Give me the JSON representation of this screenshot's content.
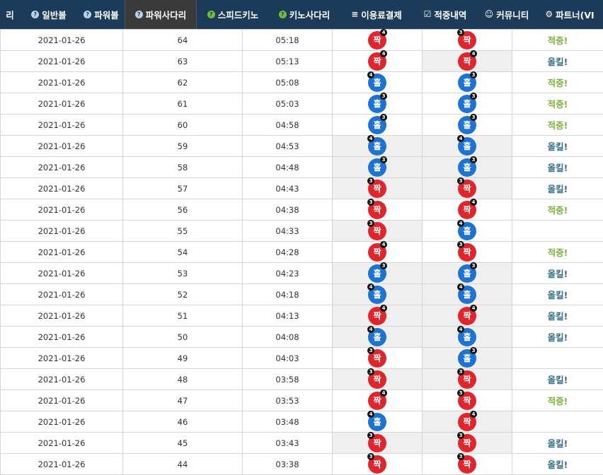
{
  "nav": {
    "items": [
      {
        "name": "nav-item-left-cut",
        "label": "리",
        "icon": "",
        "icon_type": "",
        "width": 28,
        "active": false
      },
      {
        "name": "nav-item-general-ball",
        "label": "일반볼",
        "icon": "?",
        "icon_type": "q",
        "width": 82,
        "active": false
      },
      {
        "name": "nav-item-powerball",
        "label": "파워볼",
        "icon": "?",
        "icon_type": "q",
        "width": 66,
        "active": false
      },
      {
        "name": "nav-item-power-ladder",
        "label": "파워사다리",
        "icon": "?",
        "icon_type": "q",
        "width": 102,
        "active": true
      },
      {
        "name": "nav-item-speed-keno",
        "label": "스피드키노",
        "icon": "?",
        "icon_type": "g",
        "width": 102,
        "active": false
      },
      {
        "name": "nav-item-keno-ladder",
        "label": "키노사다리",
        "icon": "?",
        "icon_type": "g",
        "width": 100,
        "active": false
      },
      {
        "name": "nav-item-payment",
        "label": "이용료결제",
        "icon": "≡",
        "icon_type": "plain",
        "width": 104,
        "active": false
      },
      {
        "name": "nav-item-hit-history",
        "label": "적중내역",
        "icon": "☑",
        "icon_type": "plain",
        "width": 90,
        "active": false
      },
      {
        "name": "nav-item-community",
        "label": "커뮤니티",
        "icon": "☺",
        "icon_type": "plain",
        "width": 84,
        "active": false
      },
      {
        "name": "nav-item-partner",
        "label": "파트너(VI",
        "icon": "⚙",
        "icon_type": "plain",
        "width": 94,
        "active": false
      }
    ]
  },
  "colors": {
    "even_ball": "#e0262d",
    "odd_ball": "#1e73d2",
    "hit": "#7bb13c",
    "kill": "#2f6b84",
    "nav_bg": "#1b3b59"
  },
  "rows": [
    {
      "date": "2021-01-26",
      "round": "64",
      "time": "05:18",
      "actual": {
        "label": "짝",
        "type": "even",
        "badge": "4",
        "side": "right"
      },
      "pick": {
        "label": "짝",
        "type": "even",
        "badge": "3",
        "side": "left"
      },
      "actual_miss": false,
      "pick_miss": false,
      "result": "적중!",
      "result_type": "hit"
    },
    {
      "date": "2021-01-26",
      "round": "63",
      "time": "05:13",
      "actual": {
        "label": "짝",
        "type": "even",
        "badge": "4",
        "side": "right"
      },
      "pick": {
        "label": "짝",
        "type": "even",
        "badge": "4",
        "side": "right"
      },
      "actual_miss": false,
      "pick_miss": true,
      "result": "올킬!",
      "result_type": "kill"
    },
    {
      "date": "2021-01-26",
      "round": "62",
      "time": "05:08",
      "actual": {
        "label": "홀",
        "type": "odd",
        "badge": "4",
        "side": "left"
      },
      "pick": {
        "label": "홀",
        "type": "odd",
        "badge": "3",
        "side": "right"
      },
      "actual_miss": false,
      "pick_miss": false,
      "result": "적중!",
      "result_type": "hit"
    },
    {
      "date": "2021-01-26",
      "round": "61",
      "time": "05:03",
      "actual": {
        "label": "홀",
        "type": "odd",
        "badge": "3",
        "side": "right"
      },
      "pick": {
        "label": "홀",
        "type": "odd",
        "badge": "3",
        "side": "right"
      },
      "actual_miss": false,
      "pick_miss": false,
      "result": "적중!",
      "result_type": "hit"
    },
    {
      "date": "2021-01-26",
      "round": "60",
      "time": "04:58",
      "actual": {
        "label": "홀",
        "type": "odd",
        "badge": "3",
        "side": "right"
      },
      "pick": {
        "label": "홀",
        "type": "odd",
        "badge": "3",
        "side": "right"
      },
      "actual_miss": false,
      "pick_miss": false,
      "result": "적중!",
      "result_type": "hit"
    },
    {
      "date": "2021-01-26",
      "round": "59",
      "time": "04:53",
      "actual": {
        "label": "홀",
        "type": "odd",
        "badge": "4",
        "side": "left"
      },
      "pick": {
        "label": "홀",
        "type": "odd",
        "badge": "4",
        "side": "left"
      },
      "actual_miss": true,
      "pick_miss": true,
      "result": "올킬!",
      "result_type": "kill"
    },
    {
      "date": "2021-01-26",
      "round": "58",
      "time": "04:48",
      "actual": {
        "label": "홀",
        "type": "odd",
        "badge": "3",
        "side": "right"
      },
      "pick": {
        "label": "홀",
        "type": "odd",
        "badge": "3",
        "side": "right"
      },
      "actual_miss": true,
      "pick_miss": true,
      "result": "올킬!",
      "result_type": "kill"
    },
    {
      "date": "2021-01-26",
      "round": "57",
      "time": "04:43",
      "actual": {
        "label": "짝",
        "type": "even",
        "badge": "3",
        "side": "left"
      },
      "pick": {
        "label": "짝",
        "type": "even",
        "badge": "3",
        "side": "left"
      },
      "actual_miss": true,
      "pick_miss": true,
      "result": "올킬!",
      "result_type": "kill"
    },
    {
      "date": "2021-01-26",
      "round": "56",
      "time": "04:38",
      "actual": {
        "label": "짝",
        "type": "even",
        "badge": "3",
        "side": "left"
      },
      "pick": {
        "label": "짝",
        "type": "even",
        "badge": "4",
        "side": "right"
      },
      "actual_miss": false,
      "pick_miss": false,
      "result": "적중!",
      "result_type": "hit"
    },
    {
      "date": "2021-01-26",
      "round": "55",
      "time": "04:33",
      "actual": {
        "label": "짝",
        "type": "even",
        "badge": "3",
        "side": "left"
      },
      "pick": {
        "label": "홀",
        "type": "odd",
        "badge": "4",
        "side": "left"
      },
      "actual_miss": true,
      "pick_miss": false,
      "result": "",
      "result_type": "none"
    },
    {
      "date": "2021-01-26",
      "round": "54",
      "time": "04:28",
      "actual": {
        "label": "짝",
        "type": "even",
        "badge": "4",
        "side": "right"
      },
      "pick": {
        "label": "짝",
        "type": "even",
        "badge": "3",
        "side": "left"
      },
      "actual_miss": false,
      "pick_miss": false,
      "result": "적중!",
      "result_type": "hit"
    },
    {
      "date": "2021-01-26",
      "round": "53",
      "time": "04:23",
      "actual": {
        "label": "홀",
        "type": "odd",
        "badge": "3",
        "side": "right"
      },
      "pick": {
        "label": "홀",
        "type": "odd",
        "badge": "3",
        "side": "right"
      },
      "actual_miss": true,
      "pick_miss": true,
      "result": "올킬!",
      "result_type": "kill"
    },
    {
      "date": "2021-01-26",
      "round": "52",
      "time": "04:18",
      "actual": {
        "label": "홀",
        "type": "odd",
        "badge": "4",
        "side": "left"
      },
      "pick": {
        "label": "홀",
        "type": "odd",
        "badge": "4",
        "side": "left"
      },
      "actual_miss": true,
      "pick_miss": true,
      "result": "올킬!",
      "result_type": "kill"
    },
    {
      "date": "2021-01-26",
      "round": "51",
      "time": "04:13",
      "actual": {
        "label": "짝",
        "type": "even",
        "badge": "4",
        "side": "right"
      },
      "pick": {
        "label": "짝",
        "type": "even",
        "badge": "4",
        "side": "right"
      },
      "actual_miss": true,
      "pick_miss": true,
      "result": "올킬!",
      "result_type": "kill"
    },
    {
      "date": "2021-01-26",
      "round": "50",
      "time": "04:08",
      "actual": {
        "label": "홀",
        "type": "odd",
        "badge": "4",
        "side": "left"
      },
      "pick": {
        "label": "홀",
        "type": "odd",
        "badge": "4",
        "side": "left"
      },
      "actual_miss": true,
      "pick_miss": true,
      "result": "올킬!",
      "result_type": "kill"
    },
    {
      "date": "2021-01-26",
      "round": "49",
      "time": "04:03",
      "actual": {
        "label": "짝",
        "type": "even",
        "badge": "3",
        "side": "left"
      },
      "pick": {
        "label": "홀",
        "type": "odd",
        "badge": "3",
        "side": "right"
      },
      "actual_miss": false,
      "pick_miss": true,
      "result": "",
      "result_type": "none"
    },
    {
      "date": "2021-01-26",
      "round": "48",
      "time": "03:58",
      "actual": {
        "label": "짝",
        "type": "even",
        "badge": "3",
        "side": "left"
      },
      "pick": {
        "label": "짝",
        "type": "even",
        "badge": "3",
        "side": "left"
      },
      "actual_miss": true,
      "pick_miss": true,
      "result": "올킬!",
      "result_type": "kill"
    },
    {
      "date": "2021-01-26",
      "round": "47",
      "time": "03:53",
      "actual": {
        "label": "짝",
        "type": "even",
        "badge": "4",
        "side": "right"
      },
      "pick": {
        "label": "짝",
        "type": "even",
        "badge": "3",
        "side": "left"
      },
      "actual_miss": false,
      "pick_miss": false,
      "result": "적중!",
      "result_type": "hit"
    },
    {
      "date": "2021-01-26",
      "round": "46",
      "time": "03:48",
      "actual": {
        "label": "홀",
        "type": "odd",
        "badge": "4",
        "side": "left"
      },
      "pick": {
        "label": "짝",
        "type": "even",
        "badge": "4",
        "side": "right"
      },
      "actual_miss": false,
      "pick_miss": true,
      "result": "",
      "result_type": "none"
    },
    {
      "date": "2021-01-26",
      "round": "45",
      "time": "03:43",
      "actual": {
        "label": "짝",
        "type": "even",
        "badge": "3",
        "side": "left"
      },
      "pick": {
        "label": "짝",
        "type": "even",
        "badge": "3",
        "side": "left"
      },
      "actual_miss": true,
      "pick_miss": true,
      "result": "올킬!",
      "result_type": "kill"
    },
    {
      "date": "2021-01-26",
      "round": "44",
      "time": "03:38",
      "actual": {
        "label": "짝",
        "type": "even",
        "badge": "3",
        "side": "left"
      },
      "pick": {
        "label": "짝",
        "type": "even",
        "badge": "3",
        "side": "left"
      },
      "actual_miss": false,
      "pick_miss": false,
      "result": "올킬!",
      "result_type": "kill"
    }
  ]
}
